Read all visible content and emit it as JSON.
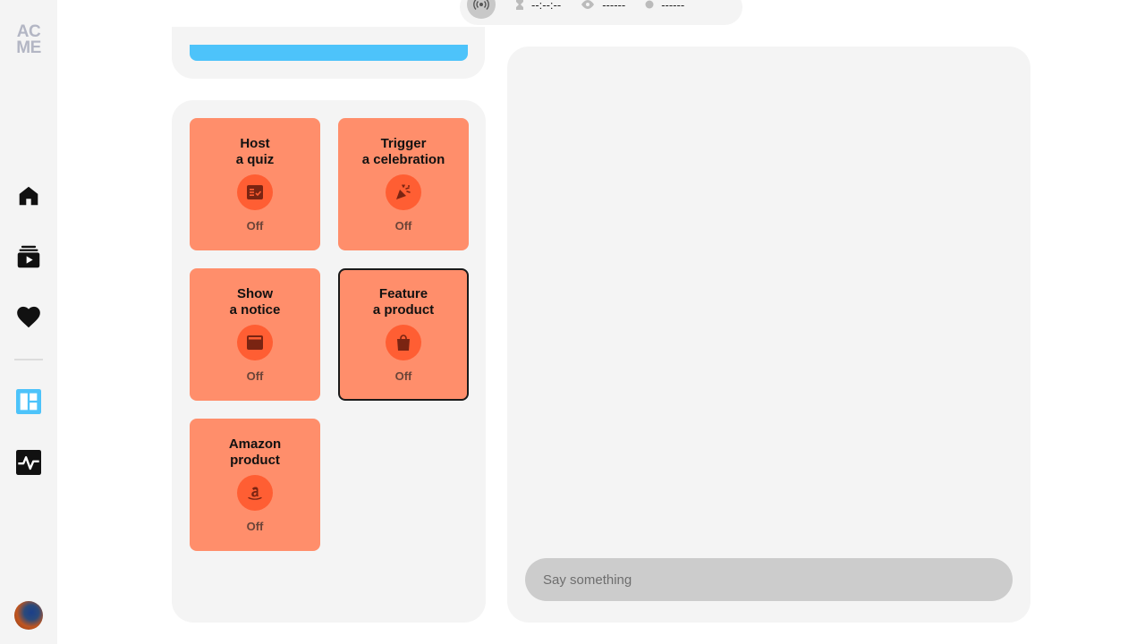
{
  "sidebar": {
    "logo_line1": "AC",
    "logo_line2": "ME",
    "items": [
      {
        "name": "home",
        "icon": "home-icon"
      },
      {
        "name": "videos",
        "icon": "video-library-icon"
      },
      {
        "name": "favorites",
        "icon": "heart-icon"
      },
      {
        "name": "dashboard",
        "icon": "dashboard-icon",
        "color": "#4dc3fa"
      },
      {
        "name": "analytics",
        "icon": "activity-icon"
      }
    ]
  },
  "status": {
    "time": "--:--:--",
    "viewers": "------",
    "other": "------"
  },
  "actions": [
    {
      "title_line1": "Host",
      "title_line2": "a quiz",
      "status": "Off",
      "icon": "quiz-icon"
    },
    {
      "title_line1": "Trigger",
      "title_line2": "a celebration",
      "status": "Off",
      "icon": "party-popper-icon"
    },
    {
      "title_line1": "Show",
      "title_line2": "a notice",
      "status": "Off",
      "icon": "notice-icon"
    },
    {
      "title_line1": "Feature",
      "title_line2": "a product",
      "status": "Off",
      "icon": "shopping-bag-icon",
      "selected": true
    },
    {
      "title_line1": "Amazon",
      "title_line2": "product",
      "status": "Off",
      "icon": "amazon-icon"
    }
  ],
  "chat": {
    "placeholder": "Say something"
  },
  "colors": {
    "card": "#ff8e6b",
    "card_icon_bg": "#ff5e33",
    "accent": "#4dc3fa",
    "panel": "#f4f4f4"
  }
}
